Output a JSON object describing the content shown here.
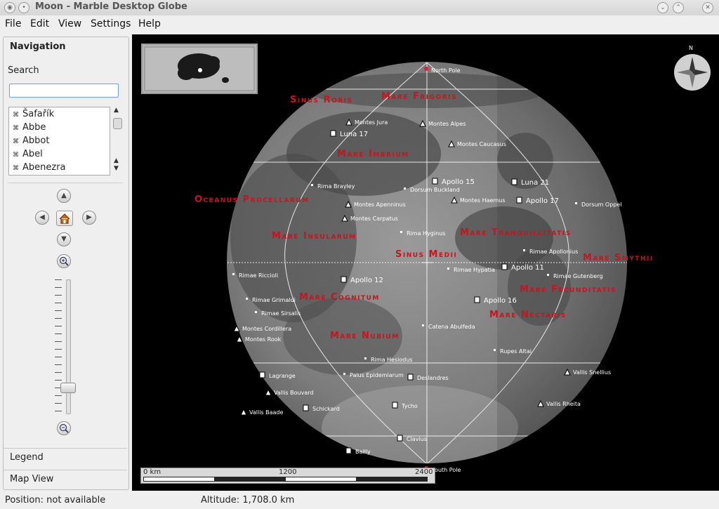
{
  "window": {
    "title": "Moon - Marble Desktop Globe"
  },
  "menu": {
    "file": "File",
    "edit": "Edit",
    "view": "View",
    "settings": "Settings",
    "help": "Help"
  },
  "navigation": {
    "title": "Navigation",
    "search_label": "Search",
    "search_value": "",
    "items": [
      "Šafařík",
      "Abbe",
      "Abbot",
      "Abel",
      "Abenezra"
    ]
  },
  "tabs": {
    "legend": "Legend",
    "map_view": "Map View"
  },
  "status": {
    "position": "Position: not available",
    "altitude": "Altitude:  1,708.0 km"
  },
  "scale": {
    "zero": "0 km",
    "mid": "1200",
    "max": "2400"
  },
  "compass": {
    "north": "N"
  },
  "colors": {
    "maria_labels": "#c8141e",
    "feature_labels": "#ffffff",
    "grid": "#ffffff",
    "pole_dot": "#e0203a"
  },
  "maria": [
    {
      "id": "sinus-roris",
      "label": "Sinus Roris"
    },
    {
      "id": "mare-frigoris",
      "label": "Mare Frigoris"
    },
    {
      "id": "mare-imbrium",
      "label": "Mare Imbrium"
    },
    {
      "id": "oceanus-procellarum",
      "label": "Oceanus Procellarum"
    },
    {
      "id": "mare-insularum",
      "label": "Mare Insularum"
    },
    {
      "id": "mare-tranquillitatis",
      "label": "Mare Tranquillitatis"
    },
    {
      "id": "sinus-medii",
      "label": "Sinus Medii"
    },
    {
      "id": "mare-smythii",
      "label": "Mare Smythii"
    },
    {
      "id": "mare-cognitum",
      "label": "Mare Cognitum"
    },
    {
      "id": "mare-fecunditatis",
      "label": "Mare Fecunditatis"
    },
    {
      "id": "mare-nectaris",
      "label": "Mare Nectaris"
    },
    {
      "id": "mare-nubium",
      "label": "Mare Nubium"
    }
  ],
  "features": [
    {
      "id": "north-pole",
      "label": "North Pole"
    },
    {
      "id": "south-pole",
      "label": "South Pole"
    },
    {
      "id": "montes-jura",
      "label": "Montes Jura"
    },
    {
      "id": "montes-alpes",
      "label": "Montes Alpes"
    },
    {
      "id": "luna-17",
      "label": "Luna 17"
    },
    {
      "id": "montes-caucasus",
      "label": "Montes Caucasus"
    },
    {
      "id": "apollo-15",
      "label": "Apollo 15"
    },
    {
      "id": "luna-21",
      "label": "Luna 21"
    },
    {
      "id": "rima-brayley",
      "label": "Rima Brayley"
    },
    {
      "id": "dorsum-buckland",
      "label": "Dorsum Buckland"
    },
    {
      "id": "montes-apenninus",
      "label": "Montes Apenninus"
    },
    {
      "id": "montes-haemus",
      "label": "Montes Haemus"
    },
    {
      "id": "apollo-17",
      "label": "Apollo 17"
    },
    {
      "id": "dorsum-oppel",
      "label": "Dorsum Oppel"
    },
    {
      "id": "montes-carpatus",
      "label": "Montes Carpatus"
    },
    {
      "id": "rima-hyginus",
      "label": "Rima Hyginus"
    },
    {
      "id": "rimae-apollonius",
      "label": "Rimae Apollonius"
    },
    {
      "id": "rimae-riccioli",
      "label": "Rimae Riccioli"
    },
    {
      "id": "apollo-12",
      "label": "Apollo 12"
    },
    {
      "id": "rimae-hypatia",
      "label": "Rimae Hypatia"
    },
    {
      "id": "apollo-11",
      "label": "Apollo 11"
    },
    {
      "id": "rimae-gutenberg",
      "label": "Rimae Gutenberg"
    },
    {
      "id": "rimae-grimaldi",
      "label": "Rimae Grimaldi"
    },
    {
      "id": "apollo-16",
      "label": "Apollo 16"
    },
    {
      "id": "rimae-sirsalis",
      "label": "Rimae Sirsalis"
    },
    {
      "id": "montes-cordillera",
      "label": "Montes Cordillera"
    },
    {
      "id": "catena-abulfeda",
      "label": "Catena Abulfeda"
    },
    {
      "id": "montes-rook",
      "label": "Montes Rook"
    },
    {
      "id": "rupes-altai",
      "label": "Rupes Altai"
    },
    {
      "id": "rima-hesiodus",
      "label": "Rima Hesiodus"
    },
    {
      "id": "vallis-snellius",
      "label": "Vallis Snellius"
    },
    {
      "id": "lagrange",
      "label": "Lagrange"
    },
    {
      "id": "palus-epidemiarum",
      "label": "Palus Epidemiarum"
    },
    {
      "id": "deslandres",
      "label": "Deslandres"
    },
    {
      "id": "vallis-bouvard",
      "label": "Vallis Bouvard"
    },
    {
      "id": "vallis-rheita",
      "label": "Vallis Rheita"
    },
    {
      "id": "vallis-baade",
      "label": "Vallis Baade"
    },
    {
      "id": "schickard",
      "label": "Schickard"
    },
    {
      "id": "tycho",
      "label": "Tycho"
    },
    {
      "id": "clavius",
      "label": "Clavius"
    },
    {
      "id": "bailly",
      "label": "Bailly"
    }
  ]
}
